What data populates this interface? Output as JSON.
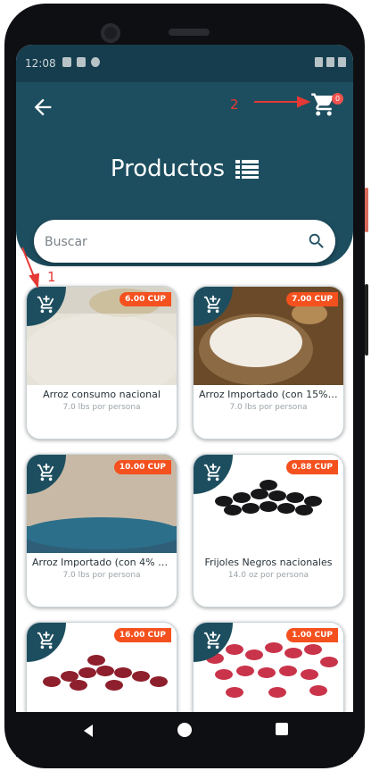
{
  "status_bar": {
    "time": "12:08"
  },
  "header": {
    "title": "Productos",
    "cart_count": "0"
  },
  "search": {
    "placeholder": "Buscar"
  },
  "products": [
    {
      "name": "Arroz consumo nacional",
      "qty": "7.0 lbs por persona",
      "price": "6.00 CUP"
    },
    {
      "name": "Arroz Importado (con 15% de ...",
      "qty": "7.0 lbs por persona",
      "price": "7.00 CUP"
    },
    {
      "name": "Arroz Importado (con 4% de ...",
      "qty": "7.0 lbs por persona",
      "price": "10.00 CUP"
    },
    {
      "name": "Frijoles Negros nacionales",
      "qty": "14.0 oz por persona",
      "price": "0.88 CUP"
    },
    {
      "name": "",
      "qty": "",
      "price": "16.00 CUP"
    },
    {
      "name": "",
      "qty": "",
      "price": "1.00 CUP"
    }
  ],
  "annotations": {
    "a1": "1",
    "a2": "2"
  },
  "colors": {
    "primary": "#1d4e5f",
    "status": "#163d4d",
    "price": "#f4511e",
    "badge": "#ef5350"
  }
}
